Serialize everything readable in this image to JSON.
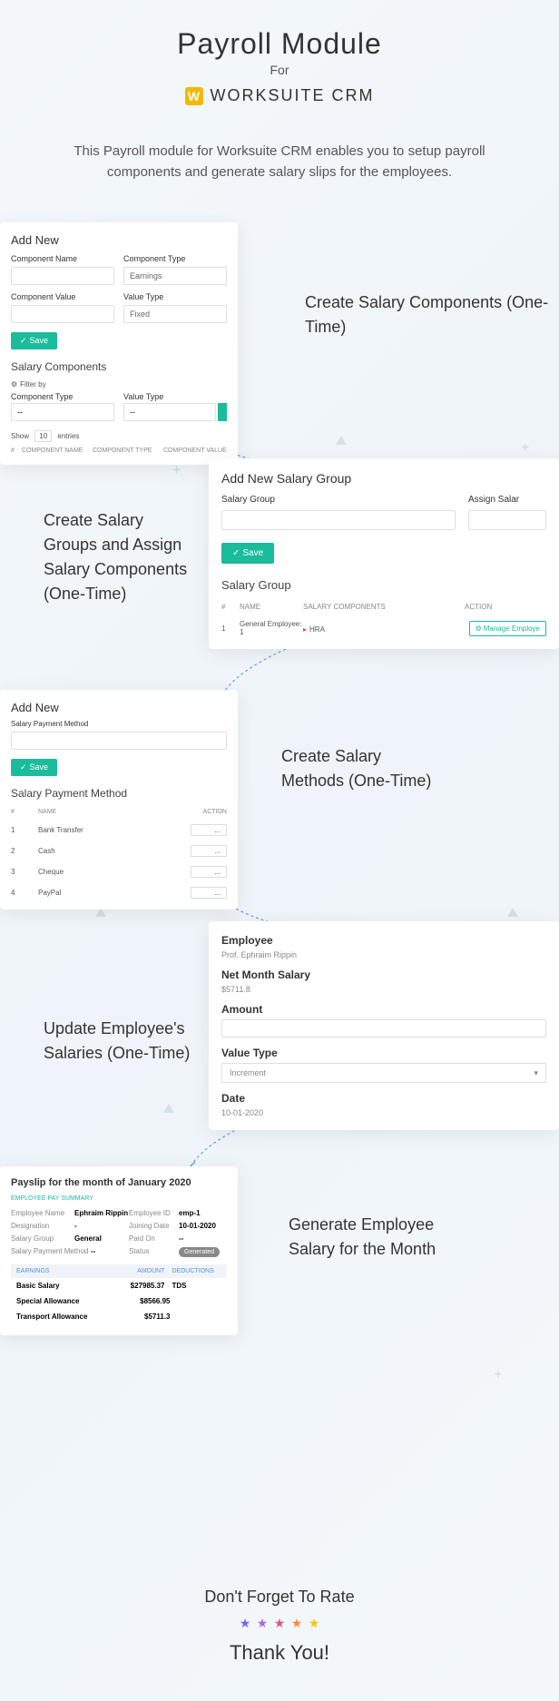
{
  "header": {
    "title": "Payroll Module",
    "subtitle": "For",
    "logo_text": "WORKSUITE CRM"
  },
  "description": "This Payroll module for Worksuite CRM enables you to setup payroll components and generate salary slips for the employees.",
  "card1": {
    "title": "Add New",
    "component_name_label": "Component Name",
    "component_type_label": "Component Type",
    "component_type_value": "Earnings",
    "component_value_label": "Component Value",
    "value_type_label": "Value Type",
    "value_type_value": "Fixed",
    "save": "Save",
    "section_title": "Salary Components",
    "filter_by": "Filter by",
    "filter_component_type": "Component Type",
    "filter_value_type": "Value Type",
    "filter_dash": "--",
    "show": "Show",
    "show_count": "10",
    "entries": "entries",
    "th_num": "#",
    "th_name": "COMPONENT NAME",
    "th_type": "COMPONENT TYPE",
    "th_value": "COMPONENT VALUE"
  },
  "caption1": "Create Salary Components (One-Time)",
  "card2": {
    "title": "Add New Salary Group",
    "salary_group_label": "Salary Group",
    "assign_label": "Assign Salar",
    "save": "Save",
    "section_title": "Salary Group",
    "th_num": "#",
    "th_name": "NAME",
    "th_comp": "SALARY COMPONENTS",
    "th_action": "ACTION",
    "row_num": "1",
    "row_name": "General Employee: 1",
    "row_comp": "HRA",
    "row_action": "Manage Employe"
  },
  "caption2": "Create Salary Groups and Assign Salary Components (One-Time)",
  "card3": {
    "title": "Add New",
    "label": "Salary Payment Method",
    "save": "Save",
    "section_title": "Salary Payment Method",
    "th_num": "#",
    "th_name": "NAME",
    "th_action": "ACTION",
    "dots": "...",
    "rows": [
      "Bank Transfer",
      "Cash",
      "Cheque",
      "PayPal"
    ]
  },
  "caption3": "Create Salary Methods (One-Time)",
  "card4": {
    "employee_label": "Employee",
    "employee_value": "Prof. Ephraim Rippin",
    "net_label": "Net Month Salary",
    "net_value": "$5711.8",
    "amount_label": "Amount",
    "value_type_label": "Value Type",
    "value_type_value": "Increment",
    "date_label": "Date",
    "date_value": "10-01-2020"
  },
  "caption4": "Update Employee's Salaries (One-Time)",
  "card5": {
    "title": "Payslip for the month of January 2020",
    "summary": "EMPLOYEE PAY SUMMARY",
    "emp_name_l": "Employee Name",
    "emp_name_v": "Ephraim Rippin",
    "emp_id_l": "Employee ID",
    "emp_id_v": "emp-1",
    "desig_l": "Designation",
    "desig_v": "-",
    "join_l": "Joining Date",
    "join_v": "10-01-2020",
    "group_l": "Salary Group",
    "group_v": "General",
    "paid_l": "Paid On",
    "paid_v": "--",
    "method_l": "Salary Payment Method",
    "method_v": "--",
    "status_l": "Status",
    "status_v": "Generated",
    "earnings_h": "EARNINGS",
    "amount_h": "AMOUNT",
    "deductions_h": "DEDUCTIONS",
    "basic": "Basic Salary",
    "basic_v": "$27985.37",
    "tds": "TDS",
    "special": "Special Allowance",
    "special_v": "$8566.95",
    "transport": "Transport Allowance",
    "transport_v": "$5711.3"
  },
  "caption5": "Generate Employee Salary for the Month",
  "footer": {
    "rate": "Don't Forget To Rate",
    "thanks": "Thank You!"
  }
}
